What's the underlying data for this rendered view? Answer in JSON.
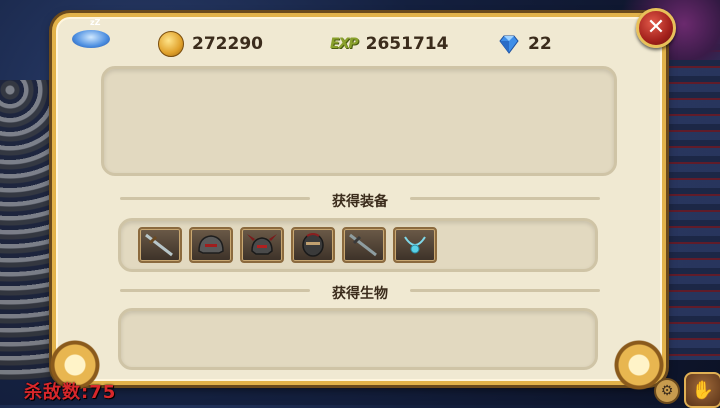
{
  "hud": {
    "kill_label": "杀敌数:75"
  },
  "panel": {
    "stats": {
      "gold": "272290",
      "exp_label": "EXP",
      "exp": "2651714",
      "gems": "22"
    },
    "sections": {
      "equipment_title": "获得装备",
      "creature_title": "获得生物"
    },
    "equipment_items": [
      {
        "icon": "sword-icon"
      },
      {
        "icon": "helmet-icon"
      },
      {
        "icon": "horned-helmet-icon"
      },
      {
        "icon": "mask-icon"
      },
      {
        "icon": "sword-icon"
      },
      {
        "icon": "necklace-icon"
      }
    ],
    "close_label": "✕"
  },
  "colors": {
    "panel_bg": "#f0e9d2",
    "panel_border": "#e2b24a",
    "close_red": "#a3211c",
    "kill_text": "#d8272b"
  }
}
